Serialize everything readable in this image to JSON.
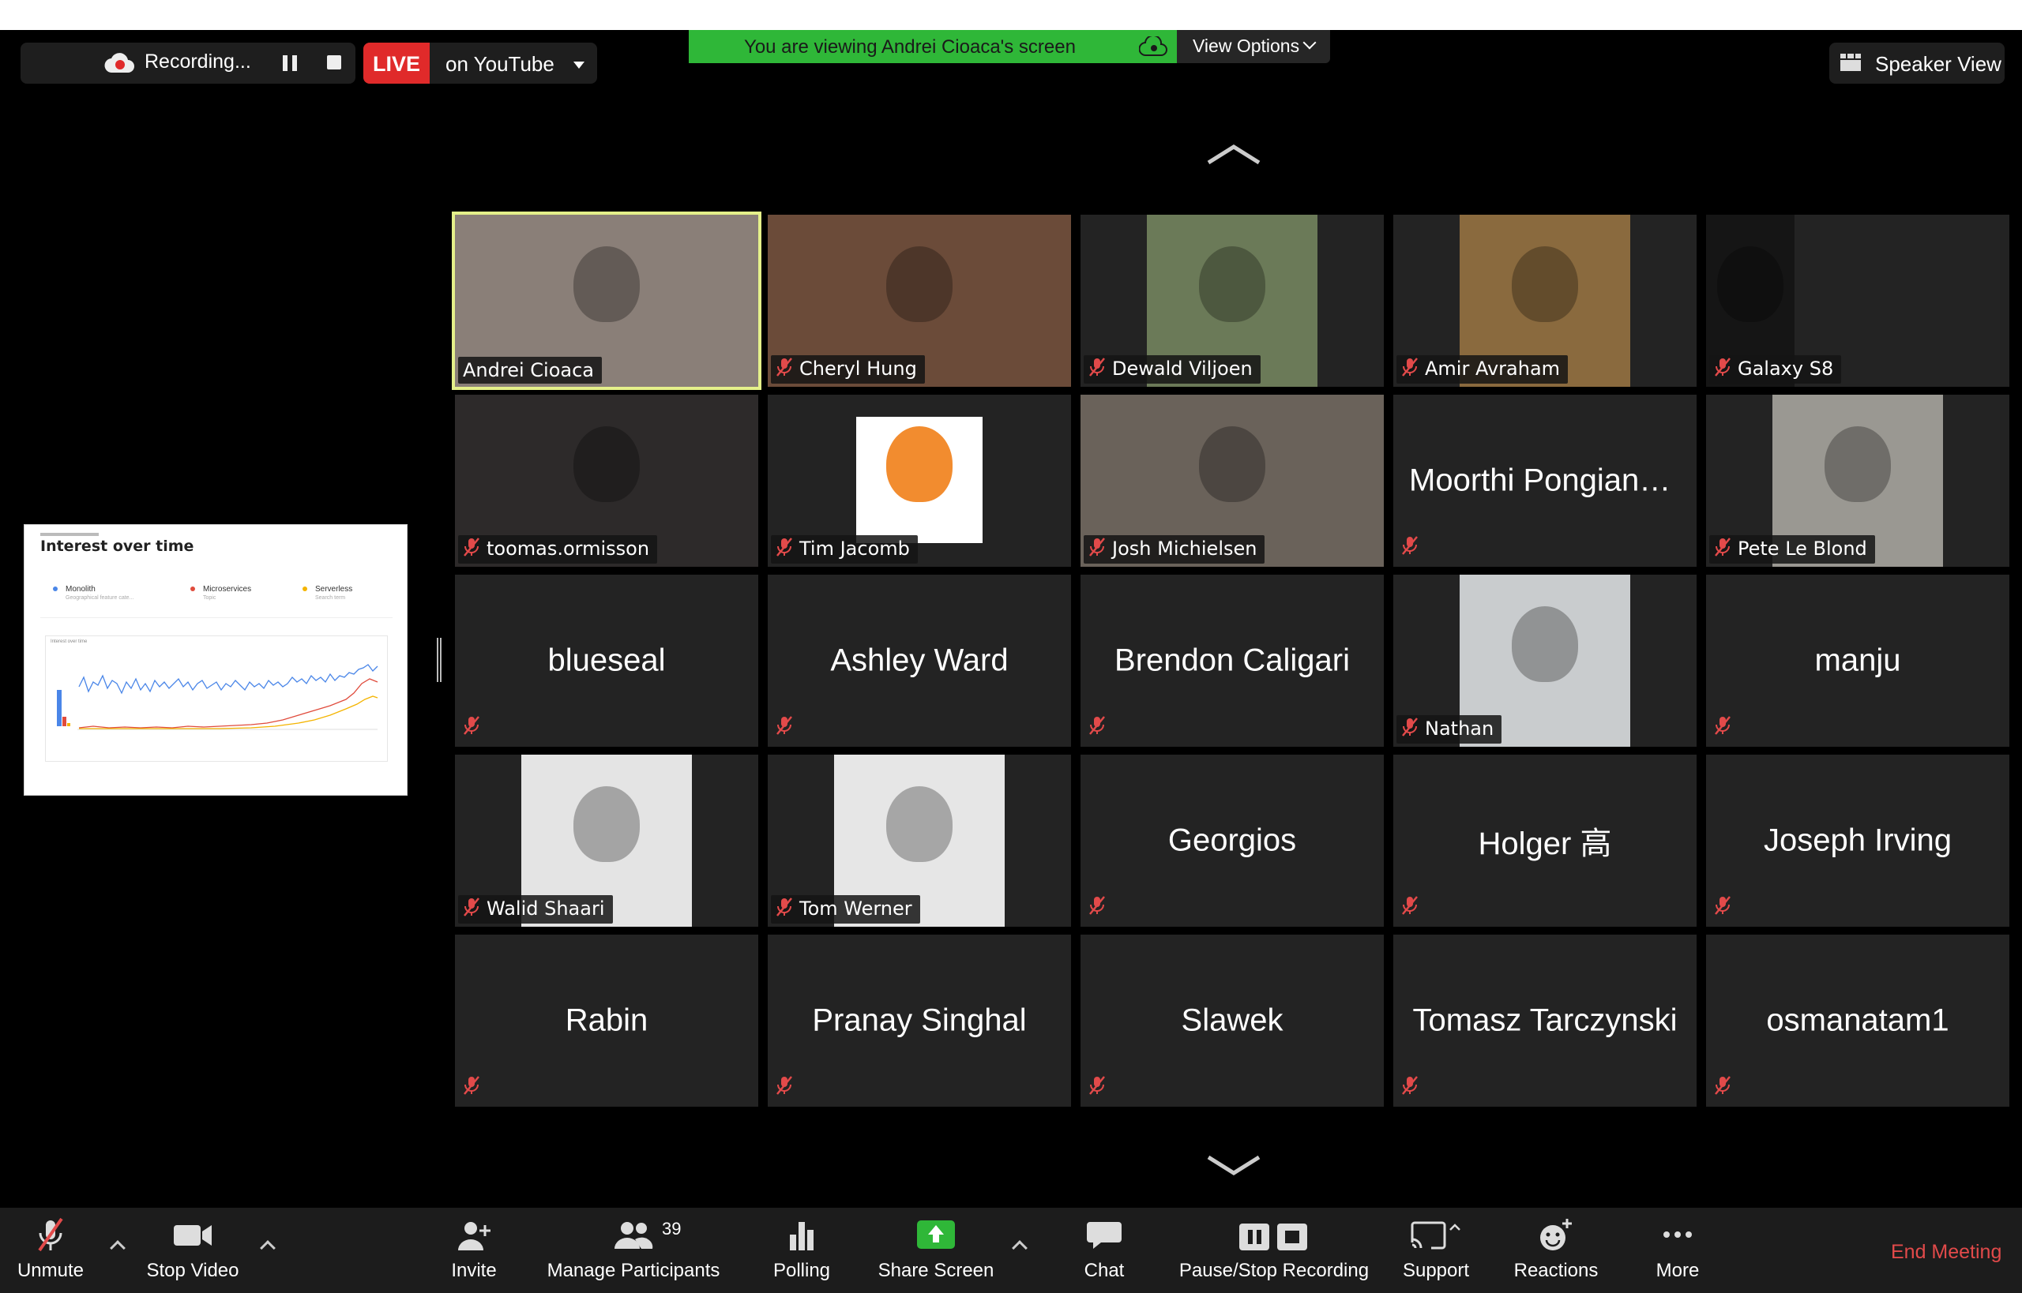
{
  "top_bar": {
    "recording_label": "Recording...",
    "live_badge": "LIVE",
    "live_destination": "on YouTube",
    "banner_text": "You are viewing Andrei Cioaca's screen",
    "view_options_label": "View Options",
    "speaker_view_label": "Speaker View"
  },
  "shared_screen": {
    "title": "Interest over time",
    "legend": [
      {
        "name": "Monolith",
        "sub": "Geographical feature cate...",
        "color": "#4a86e8"
      },
      {
        "name": "Microservices",
        "sub": "Topic",
        "color": "#e04b3c"
      },
      {
        "name": "Serverless",
        "sub": "Search term",
        "color": "#f4b400"
      }
    ],
    "inner_title": "Interest over time"
  },
  "participants": [
    {
      "name": "Andrei Cioaca",
      "video": true,
      "muted": false,
      "active": true,
      "bg": "#8a7f78"
    },
    {
      "name": "Cheryl Hung",
      "video": true,
      "muted": true,
      "bg": "#6b4b39"
    },
    {
      "name": "Dewald Viljoen",
      "video": true,
      "muted": true,
      "bg": "#6b7a58"
    },
    {
      "name": "Amir Avraham",
      "video": true,
      "muted": true,
      "bg": "#8a6a3e"
    },
    {
      "name": "Galaxy S8",
      "video": true,
      "muted": true,
      "bg": "#151515"
    },
    {
      "name": "toomas.ormisson",
      "video": true,
      "muted": true,
      "bg": "#2d2a2a"
    },
    {
      "name": "Tim Jacomb",
      "video": true,
      "muted": true,
      "bg": "#ffffff"
    },
    {
      "name": "Josh Michielsen",
      "video": true,
      "muted": true,
      "bg": "#6a625a"
    },
    {
      "name": "Moorthi Pongiann...",
      "video": false,
      "muted": true
    },
    {
      "name": "Pete Le Blond",
      "video": true,
      "muted": true,
      "bg": "#9a9892"
    },
    {
      "name": "blueseal",
      "video": false,
      "muted": true
    },
    {
      "name": "Ashley Ward",
      "video": false,
      "muted": true
    },
    {
      "name": "Brendon Caligari",
      "video": false,
      "muted": true
    },
    {
      "name": "Nathan",
      "video": true,
      "muted": true,
      "bg": "#c9ccce"
    },
    {
      "name": "manju",
      "video": false,
      "muted": true
    },
    {
      "name": "Walid Shaari",
      "video": true,
      "muted": true,
      "bg": "#e4e4e4"
    },
    {
      "name": "Tom Werner",
      "video": true,
      "muted": true,
      "bg": "#e6e6e6"
    },
    {
      "name": "Georgios",
      "video": false,
      "muted": true
    },
    {
      "name": "Holger 高",
      "video": false,
      "muted": true
    },
    {
      "name": "Joseph Irving",
      "video": false,
      "muted": true
    },
    {
      "name": "Rabin",
      "video": false,
      "muted": true
    },
    {
      "name": "Pranay Singhal",
      "video": false,
      "muted": true
    },
    {
      "name": "Slawek",
      "video": false,
      "muted": true
    },
    {
      "name": "Tomasz Tarczynski",
      "video": false,
      "muted": true
    },
    {
      "name": "osmanatam1",
      "video": false,
      "muted": true
    }
  ],
  "toolbar": {
    "unmute": "Unmute",
    "stop_video": "Stop Video",
    "invite": "Invite",
    "manage_participants": "Manage Participants",
    "participant_count": "39",
    "polling": "Polling",
    "share_screen": "Share Screen",
    "chat": "Chat",
    "pause_stop_recording": "Pause/Stop Recording",
    "support": "Support",
    "reactions": "Reactions",
    "more": "More",
    "end_meeting": "End Meeting"
  },
  "colors": {
    "live_red": "#e02a2a",
    "banner_green": "#2fb738",
    "active_speaker_outline": "#e5f08a",
    "mute_red": "#e24a4a",
    "share_green": "#2fb738"
  }
}
